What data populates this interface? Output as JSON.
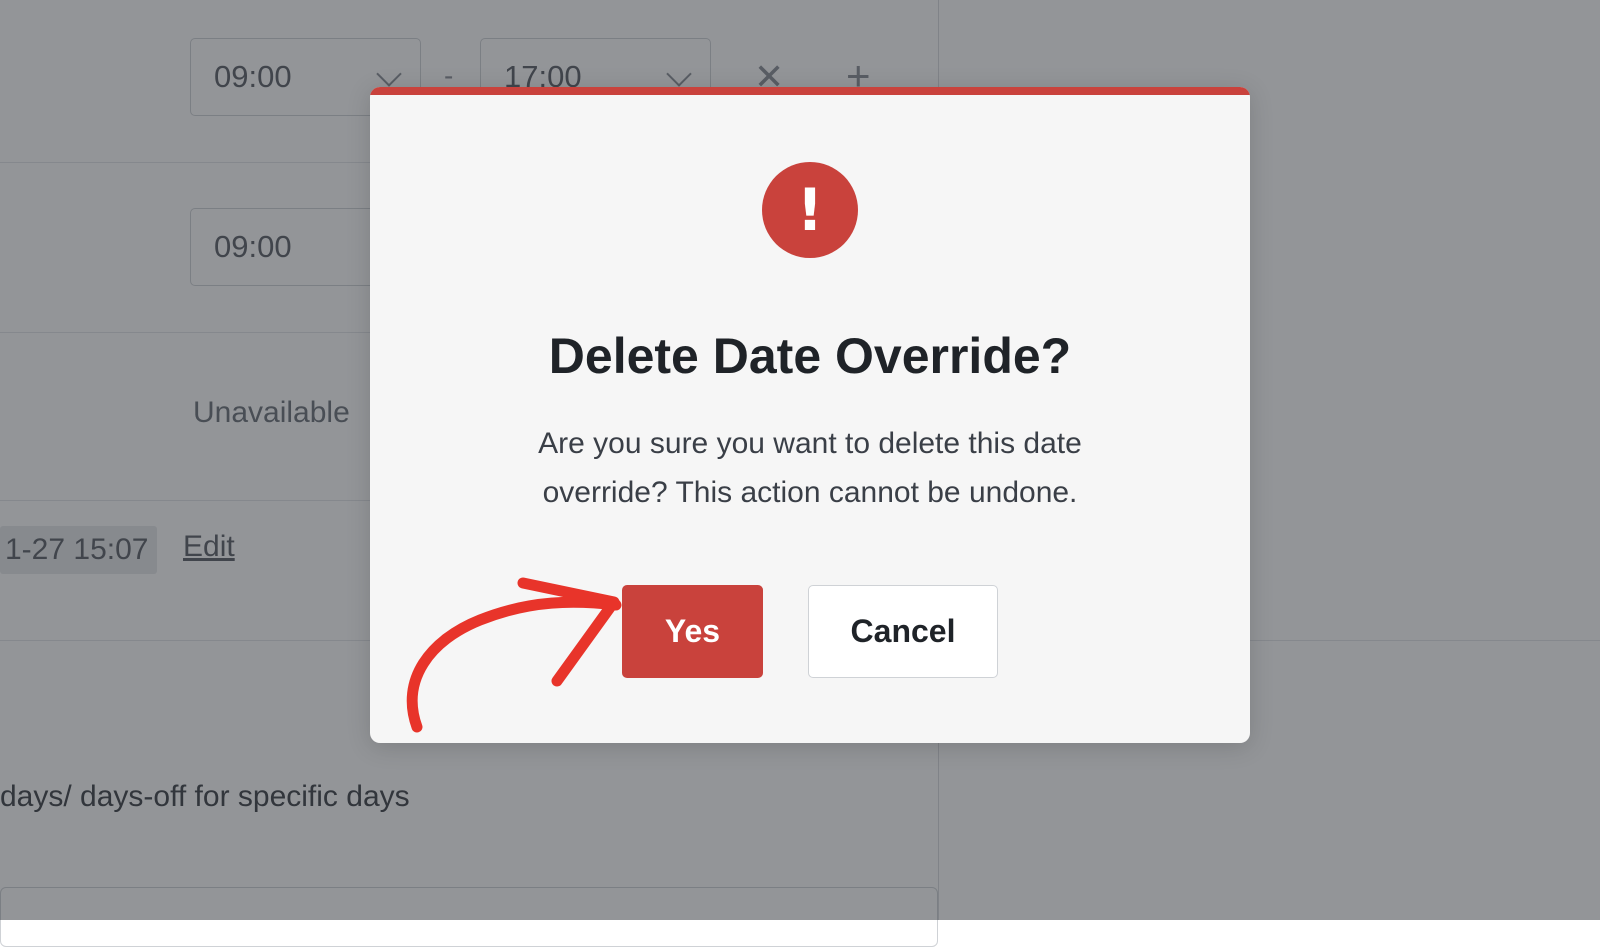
{
  "background": {
    "row1": {
      "start_time": "09:00",
      "separator": "-",
      "end_time": "17:00"
    },
    "row2": {
      "start_time": "09:00"
    },
    "unavailable_label": "Unavailable",
    "date_chip": "1-27 15:07",
    "edit_link": "Edit",
    "days_off_text": "days/ days-off for specific days"
  },
  "modal": {
    "icon": "exclamation-icon",
    "icon_glyph": "!",
    "title": "Delete Date Override?",
    "message": "Are you sure you want to delete this date override? This action cannot be undone.",
    "yes_label": "Yes",
    "cancel_label": "Cancel"
  },
  "colors": {
    "danger": "#c9423c",
    "annotation_arrow": "#e8342a",
    "overlay": "rgba(40,44,50,0.5)"
  }
}
